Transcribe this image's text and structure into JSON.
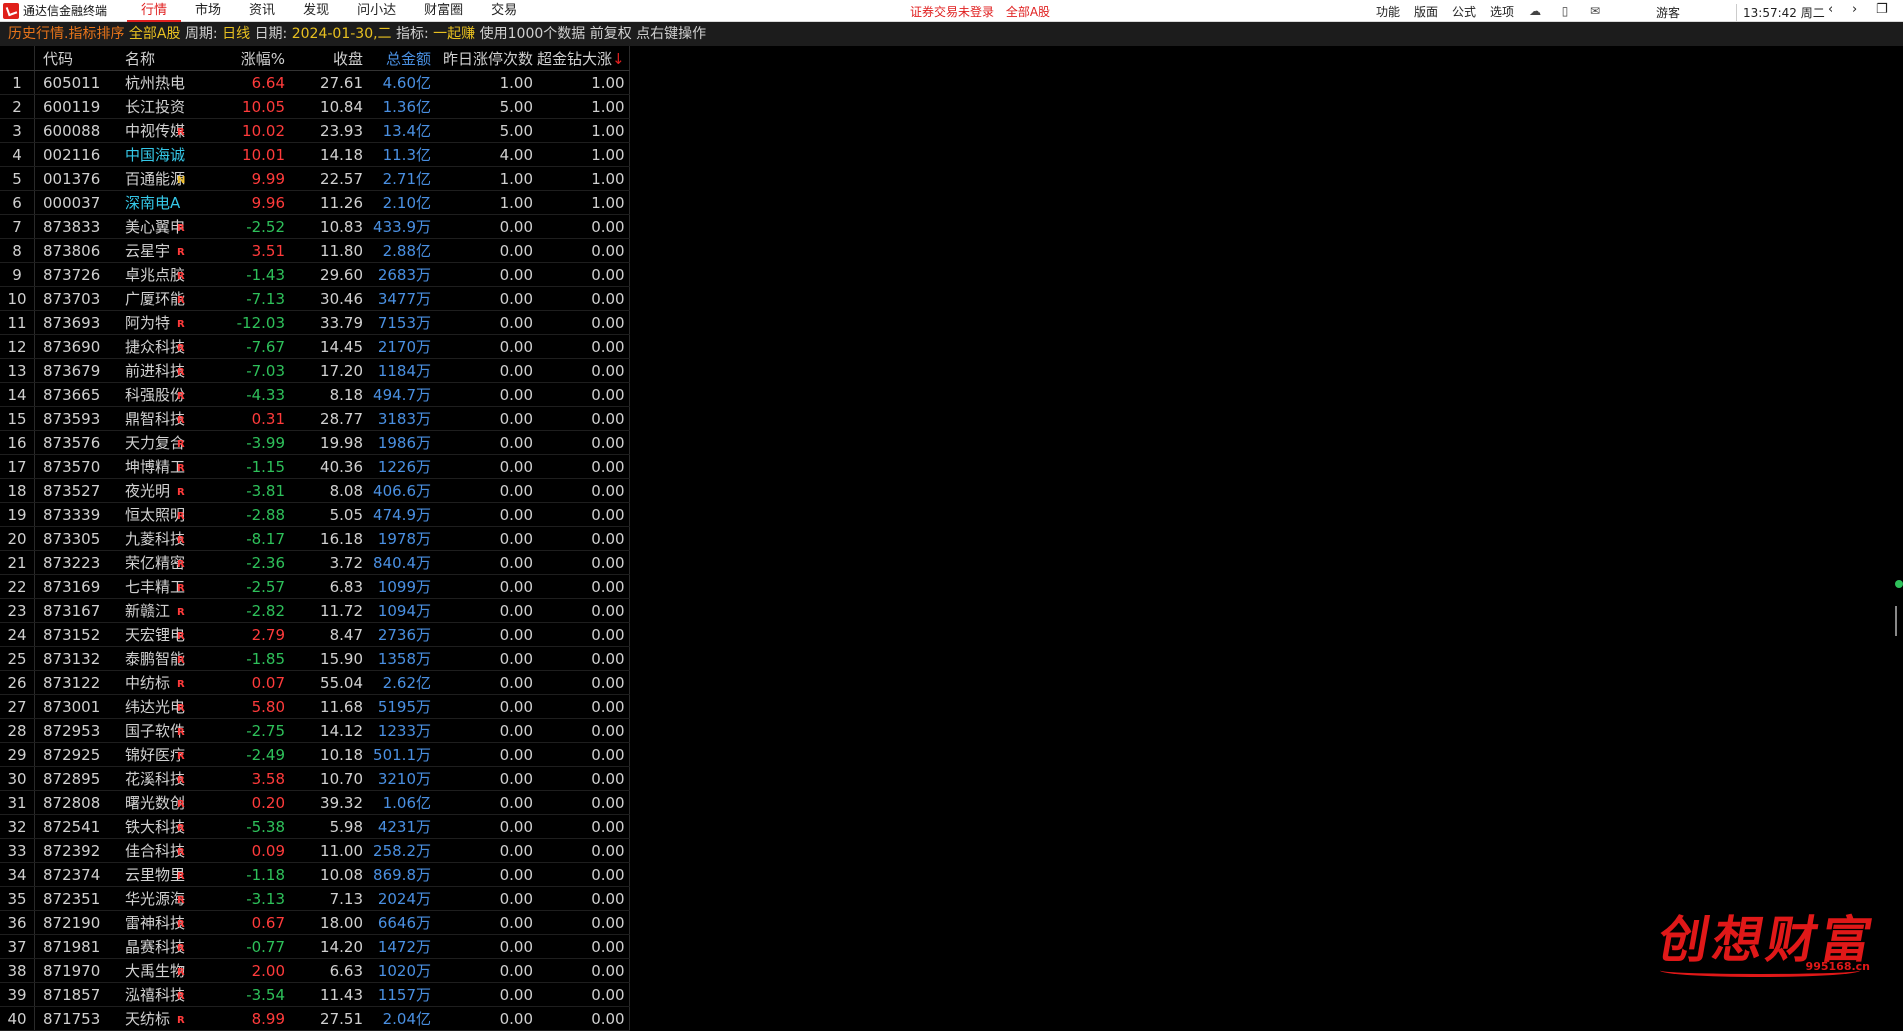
{
  "app": {
    "title": "通达信金融终端"
  },
  "menu": [
    {
      "label": "行情",
      "active": true
    },
    {
      "label": "市场",
      "active": false
    },
    {
      "label": "资讯",
      "active": false
    },
    {
      "label": "发现",
      "active": false
    },
    {
      "label": "问小达",
      "active": false
    },
    {
      "label": "财富圈",
      "active": false
    },
    {
      "label": "交易",
      "active": false
    }
  ],
  "notice": {
    "login": "证券交易未登录",
    "market": "全部A股"
  },
  "right_menu": [
    "功能",
    "版面",
    "公式",
    "选项"
  ],
  "guest": "游客",
  "clock": "13:57:42 周二",
  "status": {
    "mode": "历史行情.指标排序",
    "market": "全部A股",
    "period_label": "周期:",
    "period": "日线",
    "date_label": "日期:",
    "date": "2024-01-30,二",
    "indicator_label": "指标:",
    "indicator": "一起赚",
    "info": "使用1000个数据 前复权 点右键操作"
  },
  "columns": {
    "code": "代码",
    "name": "名称",
    "chg": "涨幅%",
    "close": "收盘",
    "amount": "总金额",
    "ztc": "昨日涨停次数",
    "cj": "超金钻大涨",
    "sort_arrow": "↓"
  },
  "rows": [
    {
      "i": "1",
      "code": "605011",
      "name": "杭州热电",
      "flag": "",
      "chg": "6.64",
      "close": "27.61",
      "amt": "4.60亿",
      "ztc": "1.00",
      "cj": "1.00",
      "dir": "red",
      "nc": ""
    },
    {
      "i": "2",
      "code": "600119",
      "name": "长江投资",
      "flag": "",
      "chg": "10.05",
      "close": "10.84",
      "amt": "1.36亿",
      "ztc": "5.00",
      "cj": "1.00",
      "dir": "red",
      "nc": ""
    },
    {
      "i": "3",
      "code": "600088",
      "name": "中视传媒",
      "flag": "R",
      "chg": "10.02",
      "close": "23.93",
      "amt": "13.4亿",
      "ztc": "5.00",
      "cj": "1.00",
      "dir": "red",
      "nc": ""
    },
    {
      "i": "4",
      "code": "002116",
      "name": "中国海诚",
      "flag": "",
      "chg": "10.01",
      "close": "14.18",
      "amt": "11.3亿",
      "ztc": "4.00",
      "cj": "1.00",
      "dir": "red",
      "nc": "cyan"
    },
    {
      "i": "5",
      "code": "001376",
      "name": "百通能源",
      "flag": "N",
      "chg": "9.99",
      "close": "22.57",
      "amt": "2.71亿",
      "ztc": "1.00",
      "cj": "1.00",
      "dir": "red",
      "nc": ""
    },
    {
      "i": "6",
      "code": "000037",
      "name": "深南电A",
      "flag": "",
      "chg": "9.96",
      "close": "11.26",
      "amt": "2.10亿",
      "ztc": "1.00",
      "cj": "1.00",
      "dir": "red",
      "nc": "cyan"
    },
    {
      "i": "7",
      "code": "873833",
      "name": "美心翼申",
      "flag": "R",
      "chg": "-2.52",
      "close": "10.83",
      "amt": "433.9万",
      "ztc": "0.00",
      "cj": "0.00",
      "dir": "green",
      "nc": ""
    },
    {
      "i": "8",
      "code": "873806",
      "name": "云星宇",
      "flag": "R",
      "chg": "3.51",
      "close": "11.80",
      "amt": "2.88亿",
      "ztc": "0.00",
      "cj": "0.00",
      "dir": "red",
      "nc": ""
    },
    {
      "i": "9",
      "code": "873726",
      "name": "卓兆点胶",
      "flag": "R",
      "chg": "-1.43",
      "close": "29.60",
      "amt": "2683万",
      "ztc": "0.00",
      "cj": "0.00",
      "dir": "green",
      "nc": ""
    },
    {
      "i": "10",
      "code": "873703",
      "name": "广厦环能",
      "flag": "R",
      "chg": "-7.13",
      "close": "30.46",
      "amt": "3477万",
      "ztc": "0.00",
      "cj": "0.00",
      "dir": "green",
      "nc": ""
    },
    {
      "i": "11",
      "code": "873693",
      "name": "阿为特",
      "flag": "R",
      "chg": "-12.03",
      "close": "33.79",
      "amt": "7153万",
      "ztc": "0.00",
      "cj": "0.00",
      "dir": "green",
      "nc": ""
    },
    {
      "i": "12",
      "code": "873690",
      "name": "捷众科技",
      "flag": "R",
      "chg": "-7.67",
      "close": "14.45",
      "amt": "2170万",
      "ztc": "0.00",
      "cj": "0.00",
      "dir": "green",
      "nc": ""
    },
    {
      "i": "13",
      "code": "873679",
      "name": "前进科技",
      "flag": "R",
      "chg": "-7.03",
      "close": "17.20",
      "amt": "1184万",
      "ztc": "0.00",
      "cj": "0.00",
      "dir": "green",
      "nc": ""
    },
    {
      "i": "14",
      "code": "873665",
      "name": "科强股份",
      "flag": "R",
      "chg": "-4.33",
      "close": "8.18",
      "amt": "494.7万",
      "ztc": "0.00",
      "cj": "0.00",
      "dir": "green",
      "nc": ""
    },
    {
      "i": "15",
      "code": "873593",
      "name": "鼎智科技",
      "flag": "R",
      "chg": "0.31",
      "close": "28.77",
      "amt": "3183万",
      "ztc": "0.00",
      "cj": "0.00",
      "dir": "red",
      "nc": ""
    },
    {
      "i": "16",
      "code": "873576",
      "name": "天力复合",
      "flag": "R",
      "chg": "-3.99",
      "close": "19.98",
      "amt": "1986万",
      "ztc": "0.00",
      "cj": "0.00",
      "dir": "green",
      "nc": ""
    },
    {
      "i": "17",
      "code": "873570",
      "name": "坤博精工",
      "flag": "R",
      "chg": "-1.15",
      "close": "40.36",
      "amt": "1226万",
      "ztc": "0.00",
      "cj": "0.00",
      "dir": "green",
      "nc": ""
    },
    {
      "i": "18",
      "code": "873527",
      "name": "夜光明",
      "flag": "R",
      "chg": "-3.81",
      "close": "8.08",
      "amt": "406.6万",
      "ztc": "0.00",
      "cj": "0.00",
      "dir": "green",
      "nc": ""
    },
    {
      "i": "19",
      "code": "873339",
      "name": "恒太照明",
      "flag": "R",
      "chg": "-2.88",
      "close": "5.05",
      "amt": "474.9万",
      "ztc": "0.00",
      "cj": "0.00",
      "dir": "green",
      "nc": ""
    },
    {
      "i": "20",
      "code": "873305",
      "name": "九菱科技",
      "flag": "R",
      "chg": "-8.17",
      "close": "16.18",
      "amt": "1978万",
      "ztc": "0.00",
      "cj": "0.00",
      "dir": "green",
      "nc": ""
    },
    {
      "i": "21",
      "code": "873223",
      "name": "荣亿精密",
      "flag": "R",
      "chg": "-2.36",
      "close": "3.72",
      "amt": "840.4万",
      "ztc": "0.00",
      "cj": "0.00",
      "dir": "green",
      "nc": ""
    },
    {
      "i": "22",
      "code": "873169",
      "name": "七丰精工",
      "flag": "R",
      "chg": "-2.57",
      "close": "6.83",
      "amt": "1099万",
      "ztc": "0.00",
      "cj": "0.00",
      "dir": "green",
      "nc": ""
    },
    {
      "i": "23",
      "code": "873167",
      "name": "新赣江",
      "flag": "R",
      "chg": "-2.82",
      "close": "11.72",
      "amt": "1094万",
      "ztc": "0.00",
      "cj": "0.00",
      "dir": "green",
      "nc": ""
    },
    {
      "i": "24",
      "code": "873152",
      "name": "天宏锂电",
      "flag": "R",
      "chg": "2.79",
      "close": "8.47",
      "amt": "2736万",
      "ztc": "0.00",
      "cj": "0.00",
      "dir": "red",
      "nc": ""
    },
    {
      "i": "25",
      "code": "873132",
      "name": "泰鹏智能",
      "flag": "R",
      "chg": "-1.85",
      "close": "15.90",
      "amt": "1358万",
      "ztc": "0.00",
      "cj": "0.00",
      "dir": "green",
      "nc": ""
    },
    {
      "i": "26",
      "code": "873122",
      "name": "中纺标",
      "flag": "R",
      "chg": "0.07",
      "close": "55.04",
      "amt": "2.62亿",
      "ztc": "0.00",
      "cj": "0.00",
      "dir": "red",
      "nc": ""
    },
    {
      "i": "27",
      "code": "873001",
      "name": "纬达光电",
      "flag": "R",
      "chg": "5.80",
      "close": "11.68",
      "amt": "5195万",
      "ztc": "0.00",
      "cj": "0.00",
      "dir": "red",
      "nc": ""
    },
    {
      "i": "28",
      "code": "872953",
      "name": "国子软件",
      "flag": "R",
      "chg": "-2.75",
      "close": "14.12",
      "amt": "1233万",
      "ztc": "0.00",
      "cj": "0.00",
      "dir": "green",
      "nc": ""
    },
    {
      "i": "29",
      "code": "872925",
      "name": "锦好医疗",
      "flag": "R",
      "chg": "-2.49",
      "close": "10.18",
      "amt": "501.1万",
      "ztc": "0.00",
      "cj": "0.00",
      "dir": "green",
      "nc": ""
    },
    {
      "i": "30",
      "code": "872895",
      "name": "花溪科技",
      "flag": "R",
      "chg": "3.58",
      "close": "10.70",
      "amt": "3210万",
      "ztc": "0.00",
      "cj": "0.00",
      "dir": "red",
      "nc": ""
    },
    {
      "i": "31",
      "code": "872808",
      "name": "曙光数创",
      "flag": "R",
      "chg": "0.20",
      "close": "39.32",
      "amt": "1.06亿",
      "ztc": "0.00",
      "cj": "0.00",
      "dir": "red",
      "nc": ""
    },
    {
      "i": "32",
      "code": "872541",
      "name": "铁大科技",
      "flag": "R",
      "chg": "-5.38",
      "close": "5.98",
      "amt": "4231万",
      "ztc": "0.00",
      "cj": "0.00",
      "dir": "green",
      "nc": ""
    },
    {
      "i": "33",
      "code": "872392",
      "name": "佳合科技",
      "flag": "R",
      "chg": "0.09",
      "close": "11.00",
      "amt": "258.2万",
      "ztc": "0.00",
      "cj": "0.00",
      "dir": "red",
      "nc": ""
    },
    {
      "i": "34",
      "code": "872374",
      "name": "云里物里",
      "flag": "R",
      "chg": "-1.18",
      "close": "10.08",
      "amt": "869.8万",
      "ztc": "0.00",
      "cj": "0.00",
      "dir": "green",
      "nc": ""
    },
    {
      "i": "35",
      "code": "872351",
      "name": "华光源海",
      "flag": "R",
      "chg": "-3.13",
      "close": "7.13",
      "amt": "2024万",
      "ztc": "0.00",
      "cj": "0.00",
      "dir": "green",
      "nc": ""
    },
    {
      "i": "36",
      "code": "872190",
      "name": "雷神科技",
      "flag": "R",
      "chg": "0.67",
      "close": "18.00",
      "amt": "6646万",
      "ztc": "0.00",
      "cj": "0.00",
      "dir": "red",
      "nc": ""
    },
    {
      "i": "37",
      "code": "871981",
      "name": "晶赛科技",
      "flag": "R",
      "chg": "-0.77",
      "close": "14.20",
      "amt": "1472万",
      "ztc": "0.00",
      "cj": "0.00",
      "dir": "green",
      "nc": ""
    },
    {
      "i": "38",
      "code": "871970",
      "name": "大禹生物",
      "flag": "R",
      "chg": "2.00",
      "close": "6.63",
      "amt": "1020万",
      "ztc": "0.00",
      "cj": "0.00",
      "dir": "red",
      "nc": ""
    },
    {
      "i": "39",
      "code": "871857",
      "name": "泓禧科技",
      "flag": "R",
      "chg": "-3.54",
      "close": "11.43",
      "amt": "1157万",
      "ztc": "0.00",
      "cj": "0.00",
      "dir": "green",
      "nc": ""
    },
    {
      "i": "40",
      "code": "871753",
      "name": "天纺标",
      "flag": "R",
      "chg": "8.99",
      "close": "27.51",
      "amt": "2.04亿",
      "ztc": "0.00",
      "cj": "0.00",
      "dir": "red",
      "nc": ""
    }
  ],
  "watermark": {
    "text": "创想财富",
    "url": "995168.cn"
  },
  "colors": {
    "up": "#ff3b3b",
    "down": "#2ec05a",
    "amount": "#4a90e2",
    "accent": "#e02020"
  }
}
